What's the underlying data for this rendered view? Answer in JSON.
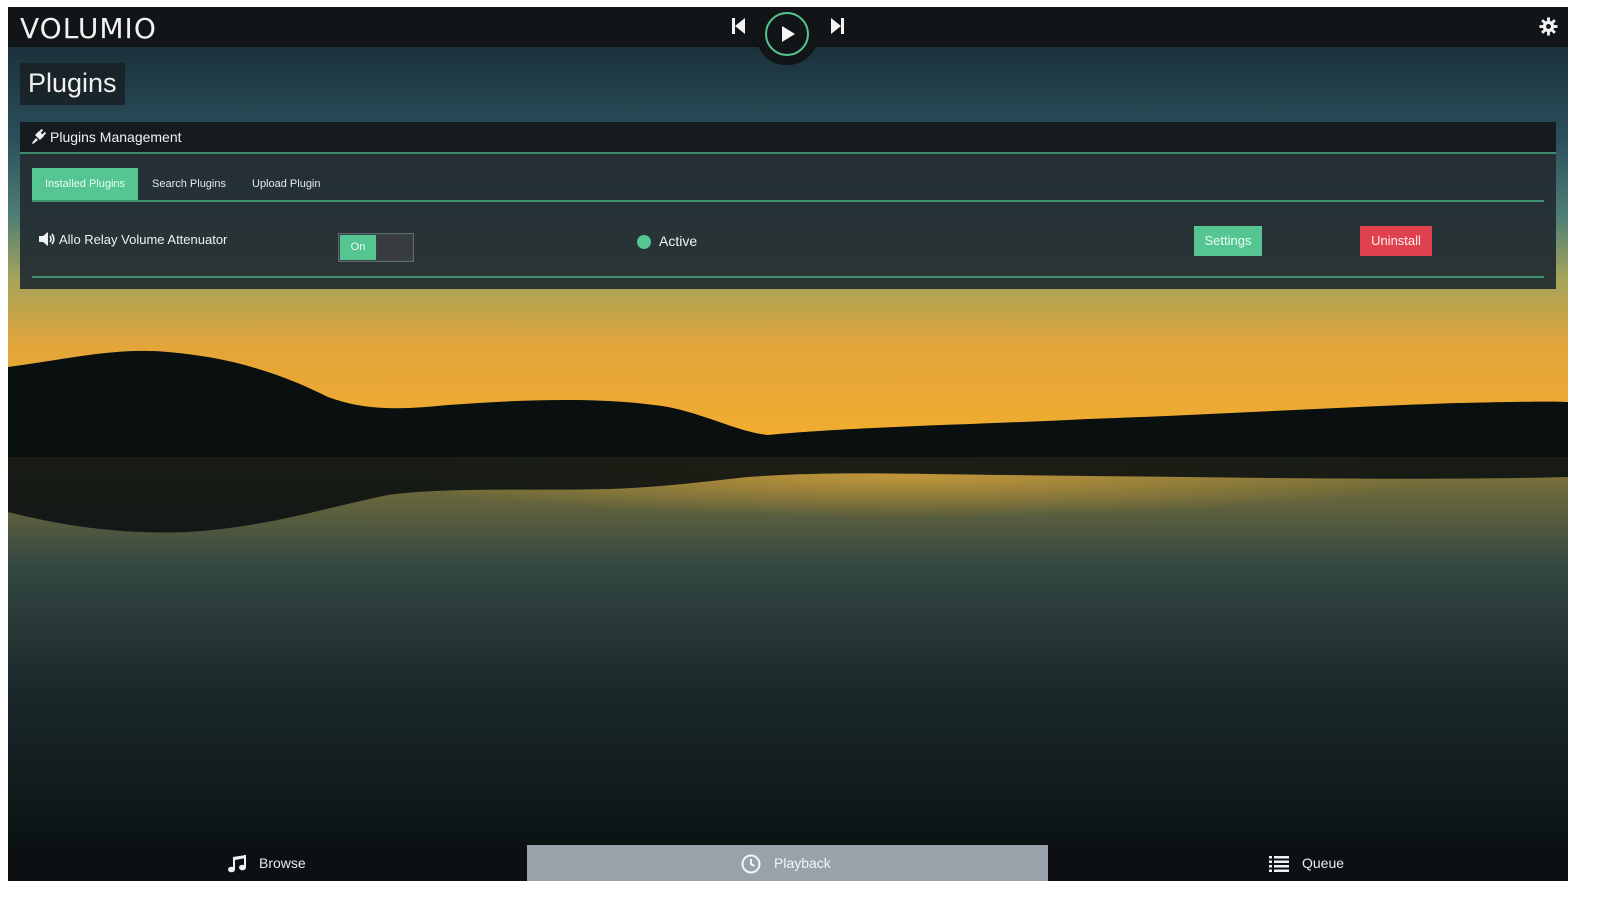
{
  "app": {
    "logo": "VOLUMIO"
  },
  "transport": {
    "prev_icon": "skip-back-icon",
    "play_icon": "play-icon",
    "next_icon": "skip-forward-icon",
    "settings_icon": "gear-icon"
  },
  "page": {
    "title": "Plugins"
  },
  "panel": {
    "title": "Plugins Management",
    "icon": "plug-icon",
    "tabs": [
      {
        "label": "Installed Plugins",
        "active": true
      },
      {
        "label": "Search Plugins",
        "active": false
      },
      {
        "label": "Upload Plugin",
        "active": false
      }
    ],
    "plugins": [
      {
        "icon": "volume-icon",
        "name": "Allo Relay Volume Attenuator",
        "toggle_label": "On",
        "enabled": true,
        "status": "Active",
        "settings_label": "Settings",
        "uninstall_label": "Uninstall"
      }
    ]
  },
  "bottom_nav": [
    {
      "label": "Browse",
      "icon": "music-note-icon",
      "active": false
    },
    {
      "label": "Playback",
      "icon": "clock-icon",
      "active": true
    },
    {
      "label": "Queue",
      "icon": "list-icon",
      "active": false
    }
  ],
  "colors": {
    "accent": "#55c592",
    "danger": "#e0414e",
    "active_tab_bg": "#99a2aa"
  }
}
